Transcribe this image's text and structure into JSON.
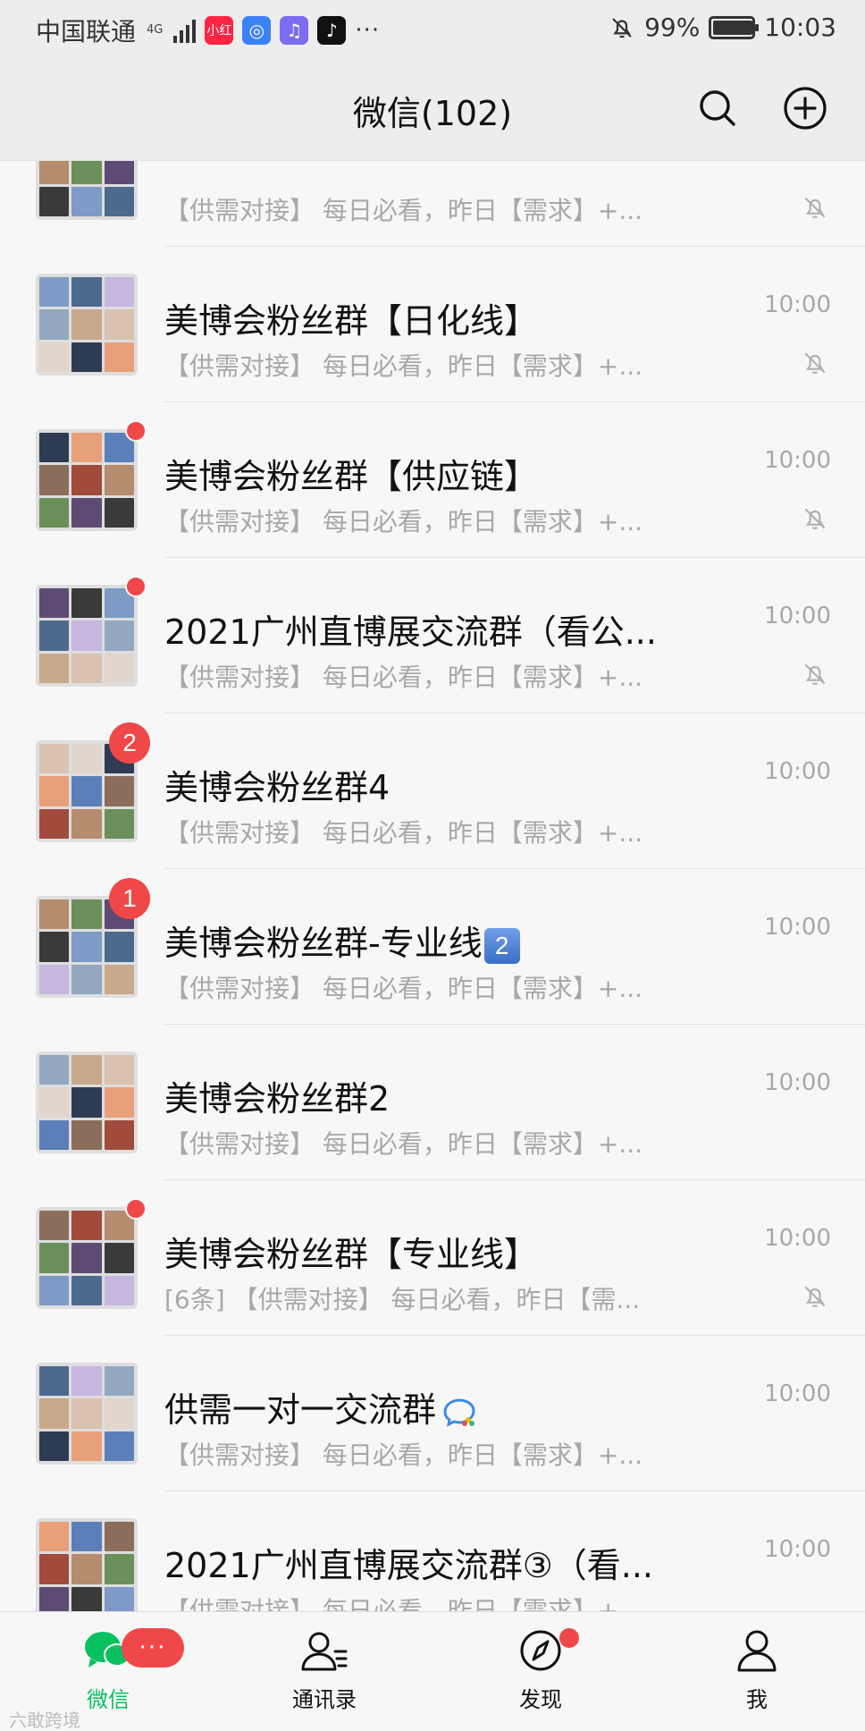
{
  "status_bar": {
    "carrier": "中国联通",
    "network": "4G",
    "app_icons": [
      {
        "name": "xiaohongshu-icon",
        "text": "小红书",
        "color": "#ff2442"
      },
      {
        "name": "browser-icon",
        "text": "",
        "color": "#3b82f6"
      },
      {
        "name": "music-icon",
        "text": "",
        "color": "#7c6cf0"
      },
      {
        "name": "tiktok-icon",
        "text": "",
        "color": "#111111"
      }
    ],
    "more": "···",
    "battery": "99%",
    "battery_level": 0.99,
    "time": "10:03"
  },
  "header": {
    "title": "微信(102)"
  },
  "chats": [
    {
      "name": "",
      "preview": "【供需对接】 每日必看，昨日【需求】+...",
      "time": "",
      "unread": "",
      "dot": false,
      "muted": true,
      "suffix": ""
    },
    {
      "name": "美博会粉丝群【日化线】",
      "preview": "【供需对接】 每日必看，昨日【需求】+...",
      "time": "10:00",
      "unread": "",
      "dot": false,
      "muted": true,
      "suffix": ""
    },
    {
      "name": "美博会粉丝群【供应链】",
      "preview": "【供需对接】 每日必看，昨日【需求】+...",
      "time": "10:00",
      "unread": "",
      "dot": true,
      "muted": true,
      "suffix": ""
    },
    {
      "name": "2021广州直博展交流群（看公...",
      "preview": "【供需对接】 每日必看，昨日【需求】+...",
      "time": "10:00",
      "unread": "",
      "dot": true,
      "muted": true,
      "suffix": ""
    },
    {
      "name": "美博会粉丝群4",
      "preview": "【供需对接】 每日必看，昨日【需求】+...",
      "time": "10:00",
      "unread": "2",
      "dot": false,
      "muted": false,
      "suffix": ""
    },
    {
      "name": "美博会粉丝群-专业线",
      "preview": "【供需对接】 每日必看，昨日【需求】+...",
      "time": "10:00",
      "unread": "1",
      "dot": false,
      "muted": false,
      "suffix": "2"
    },
    {
      "name": "美博会粉丝群2",
      "preview": "【供需对接】 每日必看，昨日【需求】+...",
      "time": "10:00",
      "unread": "",
      "dot": false,
      "muted": false,
      "suffix": ""
    },
    {
      "name": "美博会粉丝群【专业线】",
      "preview": "[6条] 【供需对接】 每日必看，昨日【需...",
      "time": "10:00",
      "unread": "",
      "dot": true,
      "muted": true,
      "suffix": ""
    },
    {
      "name": "供需一对一交流群",
      "preview": "【供需对接】 每日必看，昨日【需求】+...",
      "time": "10:00",
      "unread": "",
      "dot": false,
      "muted": false,
      "suffix": "wecom"
    },
    {
      "name": "2021广州直博展交流群③（看...",
      "preview": "【供需对接】 每日必看，昨日【需求】+...",
      "time": "10:00",
      "unread": "",
      "dot": false,
      "muted": false,
      "suffix": ""
    }
  ],
  "tabs": [
    {
      "label": "微信",
      "icon": "chat-bubble-icon",
      "active": true,
      "badge": "···"
    },
    {
      "label": "通讯录",
      "icon": "contacts-icon",
      "active": false,
      "badge": ""
    },
    {
      "label": "发现",
      "icon": "compass-icon",
      "active": false,
      "badge": "dot"
    },
    {
      "label": "我",
      "icon": "person-icon",
      "active": false,
      "badge": ""
    }
  ],
  "watermark": "六敢跨境",
  "colors": {
    "wechat_green": "#07c160",
    "badge_red": "#f04848",
    "header_bg": "#ededed",
    "list_bg": "#f7f7f7"
  }
}
